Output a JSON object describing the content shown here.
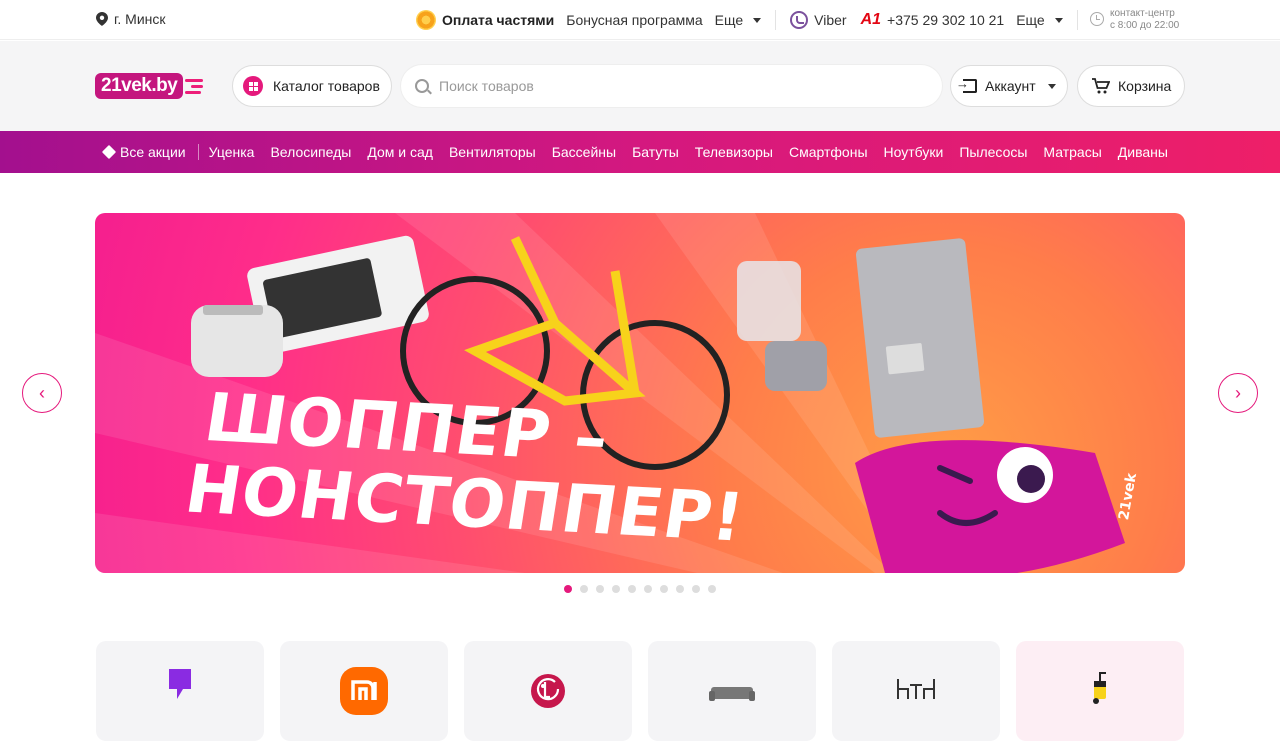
{
  "topbar": {
    "city": "г. Минск",
    "pay": "Оплата частями",
    "bonus": "Бонусная программа",
    "more1": "Еще",
    "viber": "Viber",
    "a1": "A1",
    "phone": "+375 29 302 10 21",
    "more2": "Еще",
    "contact_title": "контакт-центр",
    "contact_hours": "с 8:00 до 22:00"
  },
  "header": {
    "logo": "21vek.by",
    "catalog": "Каталог товаров",
    "search_placeholder": "Поиск товаров",
    "account": "Аккаунт",
    "cart": "Корзина"
  },
  "nav": {
    "all": "Все акции",
    "items": [
      "Уценка",
      "Велосипеды",
      "Дом и сад",
      "Вентиляторы",
      "Бассейны",
      "Батуты",
      "Телевизоры",
      "Смартфоны",
      "Ноутбуки",
      "Пылесосы",
      "Матрасы",
      "Диваны"
    ]
  },
  "banner": {
    "line1": "ШОППЕР –",
    "line2": "НОНСТОППЕР!",
    "bag_label": "21vek",
    "slides": 10,
    "active_slide": 1
  },
  "tiles": [
    "brand-1-icon",
    "xiaomi-icon",
    "lg-icon",
    "sofa-icon",
    "patio-furniture-icon",
    "pressure-washer-icon"
  ],
  "colors": {
    "brand": "#e5197c",
    "nav_start": "#a3108e",
    "nav_end": "#ee1f68"
  }
}
